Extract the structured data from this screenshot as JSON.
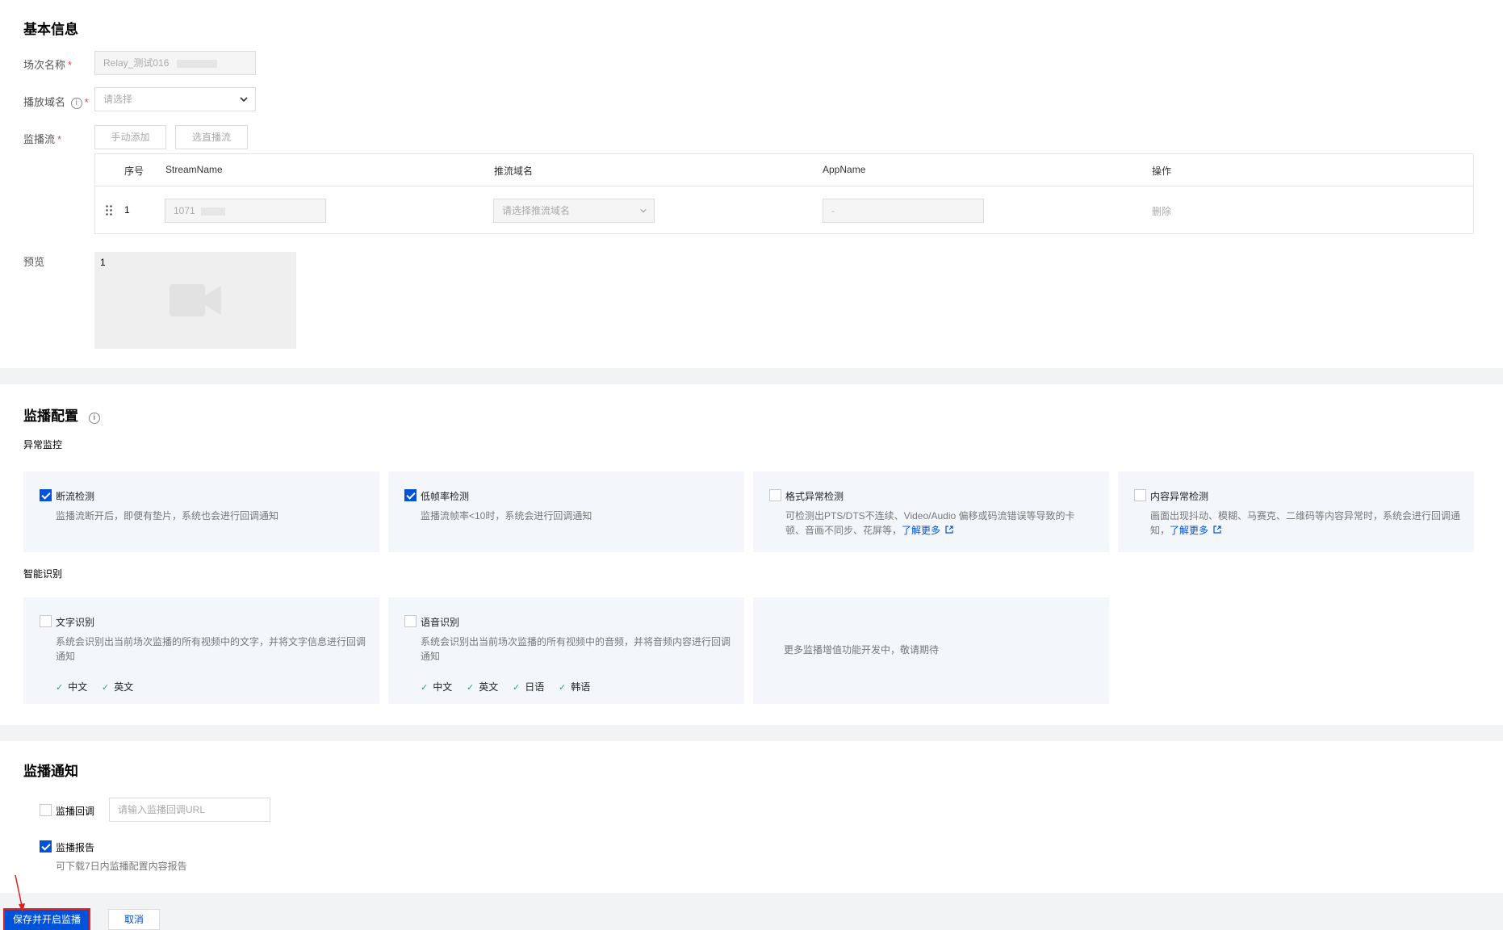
{
  "basic": {
    "title": "基本信息",
    "session_name_label": "场次名称",
    "session_name_value": "Relay_测试016",
    "domain_label": "播放域名",
    "domain_placeholder": "请选择",
    "stream_label": "监播流",
    "manual_add": "手动添加",
    "choose_stream": "选直播流",
    "required_mark": "*",
    "table": {
      "headers": [
        "序号",
        "StreamName",
        "推流域名",
        "AppName",
        "操作"
      ],
      "rows": [
        {
          "index": "1",
          "stream_name": "1071",
          "push_domain_placeholder": "请选择推流域名",
          "app_name": "-",
          "action": "删除"
        }
      ]
    },
    "preview_label": "预览",
    "preview_index": "1"
  },
  "monitor": {
    "title": "监播配置",
    "abnormal_title": "异常监控",
    "cards": [
      {
        "title": "断流检测",
        "checked": true,
        "desc": "监播流断开后，即便有垫片，系统也会进行回调通知"
      },
      {
        "title": "低帧率检测",
        "checked": true,
        "desc": "监播流帧率<10时，系统会进行回调通知"
      },
      {
        "title": "格式异常检测",
        "checked": false,
        "desc": "可检测出PTS/DTS不连续、Video/Audio 偏移或码流错误等导致的卡顿、音画不同步、花屏等，",
        "link": "了解更多"
      },
      {
        "title": "内容异常检测",
        "checked": false,
        "desc": "画面出现抖动、模糊、马赛克、二维码等内容异常时，系统会进行回调通知，",
        "link": "了解更多"
      }
    ],
    "smart_title": "智能识别",
    "smart_cards": [
      {
        "title": "文字识别",
        "checked": false,
        "desc": "系统会识别出当前场次监播的所有视频中的文字，并将文字信息进行回调通知",
        "langs": [
          "中文",
          "英文"
        ]
      },
      {
        "title": "语音识别",
        "checked": false,
        "desc": "系统会识别出当前场次监播的所有视频中的音频，并将音频内容进行回调通知",
        "langs": [
          "中文",
          "英文",
          "日语",
          "韩语"
        ]
      }
    ],
    "more_text": "更多监播增值功能开发中，敬请期待"
  },
  "notify": {
    "title": "监播通知",
    "callback_label": "监播回调",
    "callback_checked": false,
    "callback_placeholder": "请输入监播回调URL",
    "report_label": "监播报告",
    "report_checked": true,
    "report_desc": "可下载7日内监播配置内容报告"
  },
  "footer": {
    "save_label": "保存并开启监播",
    "cancel_label": "取消"
  },
  "colors": {
    "primary": "#0052d9",
    "card_bg": "#f3f7fc",
    "required": "#e54545",
    "annotation": "#e02020"
  }
}
